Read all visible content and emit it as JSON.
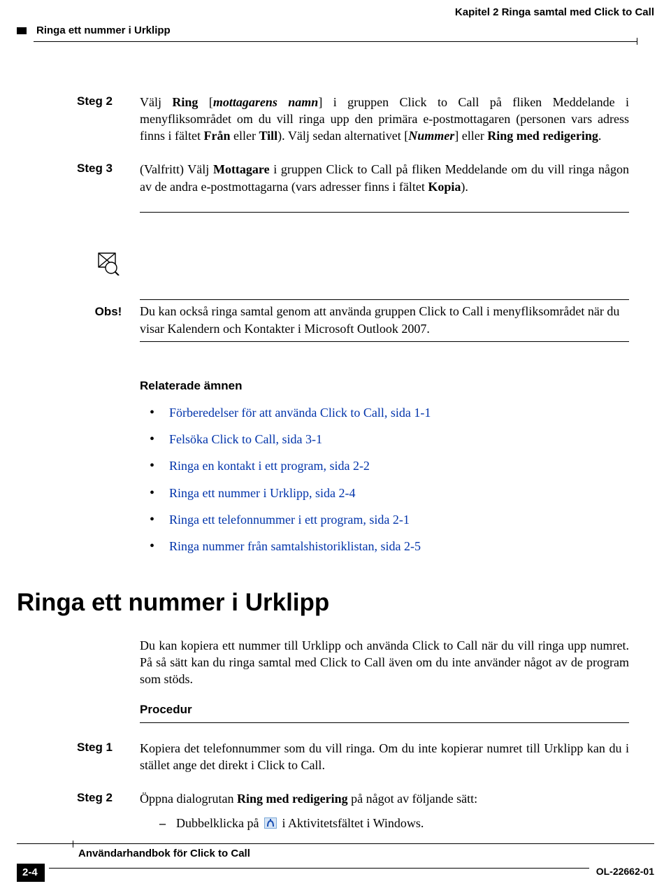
{
  "header": {
    "chapter": "Kapitel 2    Ringa samtal med Click to Call",
    "section": "Ringa ett nummer i Urklipp"
  },
  "steps": [
    {
      "label": "Steg 2",
      "parts": [
        {
          "text": "Välj "
        },
        {
          "text": "Ring",
          "bold": true
        },
        {
          "text": " ["
        },
        {
          "text": "mottagarens namn",
          "italic": true,
          "bold": true
        },
        {
          "text": "] i gruppen Click to Call på fliken Meddelande i menyfliksområdet om du vill ringa upp den primära e-postmottagaren (personen vars adress finns i fältet "
        },
        {
          "text": "Från",
          "bold": true
        },
        {
          "text": " eller "
        },
        {
          "text": "Till",
          "bold": true
        },
        {
          "text": "). Välj sedan alternativet ["
        },
        {
          "text": "Nummer",
          "italic": true,
          "bold": true
        },
        {
          "text": "] eller "
        },
        {
          "text": "Ring med redigering",
          "bold": true
        },
        {
          "text": "."
        }
      ]
    },
    {
      "label": "Steg 3",
      "parts": [
        {
          "text": "(Valfritt) Välj "
        },
        {
          "text": "Mottagare",
          "bold": true
        },
        {
          "text": " i gruppen Click to Call på fliken Meddelande om du vill ringa någon av de andra e-postmottagarna (vars adresser finns i fältet "
        },
        {
          "text": "Kopia",
          "bold": true
        },
        {
          "text": ")."
        }
      ]
    }
  ],
  "note": {
    "label": "Obs!",
    "text": "Du kan också ringa samtal genom att använda gruppen Click to Call i menyfliksområdet när du visar Kalendern och Kontakter i Microsoft Outlook 2007."
  },
  "related": {
    "heading": "Relaterade ämnen",
    "items": [
      "Förberedelser för att använda Click to Call, sida 1-1",
      "Felsöka Click to Call, sida 3-1",
      "Ringa en kontakt i ett program, sida 2-2",
      "Ringa ett nummer i Urklipp, sida 2-4",
      "Ringa ett telefonnummer i ett program, sida 2-1",
      "Ringa nummer från samtalshistoriklistan, sida 2-5"
    ]
  },
  "h1": "Ringa ett nummer i Urklipp",
  "intro": "Du kan kopiera ett nummer till Urklipp och använda Click to Call när du vill ringa upp numret. På så sätt kan du ringa samtal med Click to Call även om du inte använder något av de program som stöds.",
  "procedure": {
    "heading": "Procedur",
    "steps": [
      {
        "label": "Steg 1",
        "parts": [
          {
            "text": "Kopiera det telefonnummer som du vill ringa. Om du inte kopierar numret till Urklipp kan du i stället ange det direkt i Click to Call."
          }
        ]
      },
      {
        "label": "Steg 2",
        "parts": [
          {
            "text": "Öppna dialogrutan "
          },
          {
            "text": "Ring med redigering",
            "bold": true
          },
          {
            "text": " på något av följande sätt:"
          }
        ],
        "sub": {
          "pre": "Dubbelklicka på ",
          "post": " i Aktivitetsfältet i Windows."
        }
      }
    ]
  },
  "footer": {
    "title": "Användarhandbok för Click to Call",
    "page": "2-4",
    "docid": "OL-22662-01"
  }
}
